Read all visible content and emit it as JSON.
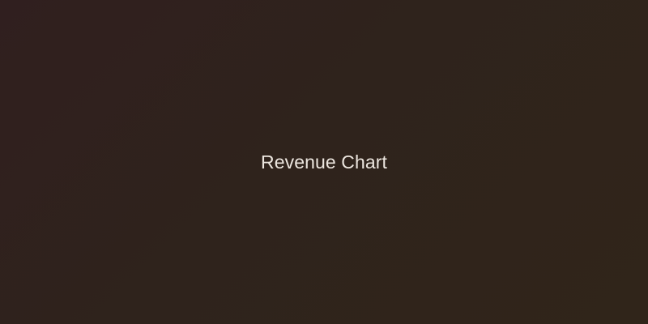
{
  "placeholder": {
    "label": "Revenue Chart",
    "text_color": "#ece6df",
    "background_colors": [
      "#301f1f",
      "#2f231c",
      "#30251a"
    ]
  }
}
